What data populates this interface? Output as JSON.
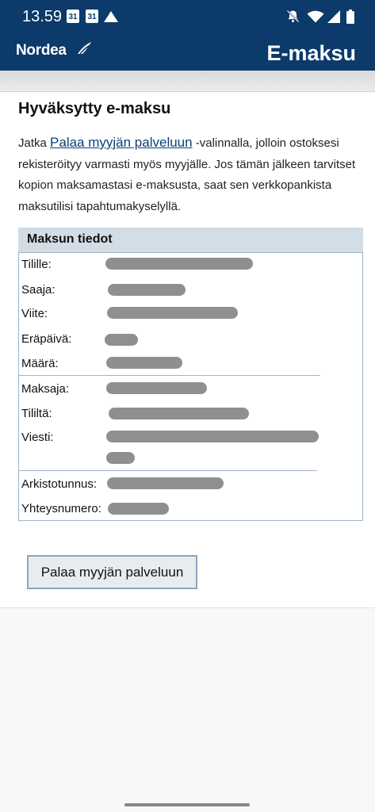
{
  "status_bar": {
    "time": "13.59",
    "calendar_day_1": "31",
    "calendar_day_2": "31"
  },
  "app_bar": {
    "logo": "Nordea",
    "title": "E-maksu"
  },
  "page": {
    "heading": "Hyväksytty e-maksu",
    "intro_before_link": "Jatka ",
    "intro_link": "Palaa myyjän palveluun",
    "intro_after_link": " -valinnalla, jolloin ostoksesi rekisteröityy varmasti myös myyjälle. Jos tämän jälkeen tarvitset kopion maksamastasi e-maksusta, saat sen verkkopankista maksutilisi tapahtumakyselyllä."
  },
  "details": {
    "header": "Maksun tiedot",
    "rows": [
      {
        "label": "Tilille:"
      },
      {
        "label": "Saaja:"
      },
      {
        "label": "Viite:"
      },
      {
        "label": "Eräpäivä:"
      },
      {
        "label": "Määrä:"
      },
      {
        "label": "Maksaja:"
      },
      {
        "label": "Tililtä:"
      },
      {
        "label": "Viesti:"
      },
      {
        "label": "Arkistotunnus:"
      },
      {
        "label": "Yhteysnumero:"
      }
    ]
  },
  "return_button": "Palaa myyjän palveluun",
  "colors": {
    "brand_blue": "#0b3a6b",
    "header_bg": "#d3dde5",
    "link": "#0c3f78"
  }
}
